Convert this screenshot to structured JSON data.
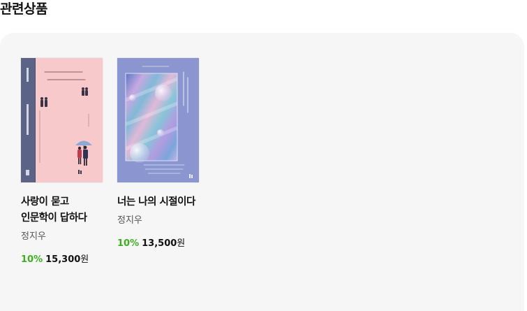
{
  "section": {
    "title": "관련상품"
  },
  "products": [
    {
      "title": "사랑이 묻고 인문학이 답하다",
      "author": "정지우",
      "discount": "10%",
      "price": "15,300",
      "currency": "원",
      "cover": {
        "background": "#f8c9cb",
        "spine": "#5b6387",
        "cover_text": "사랑이 묻고\n인문학이 답하다"
      }
    },
    {
      "title": "너는 나의 시절이다",
      "author": "정지우",
      "discount": "10%",
      "price": "13,500",
      "currency": "원",
      "cover": {
        "background": "#8b95cf",
        "cover_text": "너는 나의 시절이다"
      }
    }
  ],
  "colors": {
    "discount": "#3cb021",
    "panel": "#f6f6f6"
  }
}
